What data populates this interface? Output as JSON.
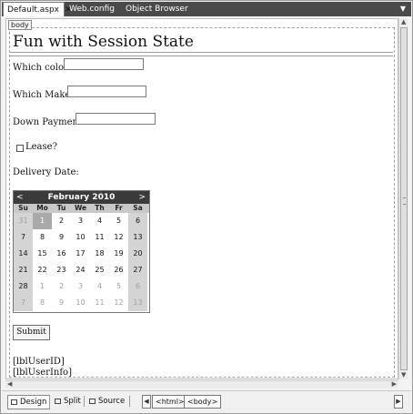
{
  "tabs": [
    {
      "label": "Default.aspx",
      "active": true,
      "close_glyph": "✕"
    },
    {
      "label": "Web.config",
      "active": false
    },
    {
      "label": "Object Browser",
      "active": false
    }
  ],
  "tabbar_dropdown_icon": "chevron-down-icon",
  "designer": {
    "body_tag": "body",
    "page_title": "Fun with Session State",
    "color_label": "Which color?",
    "make_label": "Which Make?",
    "down_payment_label": "Down Payment?",
    "lease_label": "Lease?",
    "delivery_label": "Delivery Date:",
    "submit_label": "Submit",
    "user_id_label": "[lblUserID]",
    "user_info_label": "[lblUserInfo]"
  },
  "calendar": {
    "title": "February 2010",
    "prev": "<",
    "next": ">",
    "days_of_week": [
      "Su",
      "Mo",
      "Tu",
      "We",
      "Th",
      "Fr",
      "Sa"
    ],
    "weeks": [
      [
        "31",
        "1",
        "2",
        "3",
        "4",
        "5",
        "6"
      ],
      [
        "7",
        "8",
        "9",
        "10",
        "11",
        "12",
        "13"
      ],
      [
        "14",
        "15",
        "16",
        "17",
        "18",
        "19",
        "20"
      ],
      [
        "21",
        "22",
        "23",
        "24",
        "25",
        "26",
        "27"
      ],
      [
        "28",
        "1",
        "2",
        "3",
        "4",
        "5",
        "6"
      ],
      [
        "7",
        "8",
        "9",
        "10",
        "11",
        "12",
        "13"
      ]
    ],
    "selected_day": "1",
    "header_color": "#3b3b3b",
    "weekend_color": "#d4d4d4"
  },
  "bottom_bar": {
    "design": "Design",
    "split": "Split",
    "source": "Source",
    "html_tag": "<html>",
    "body_tag": "<body>"
  }
}
